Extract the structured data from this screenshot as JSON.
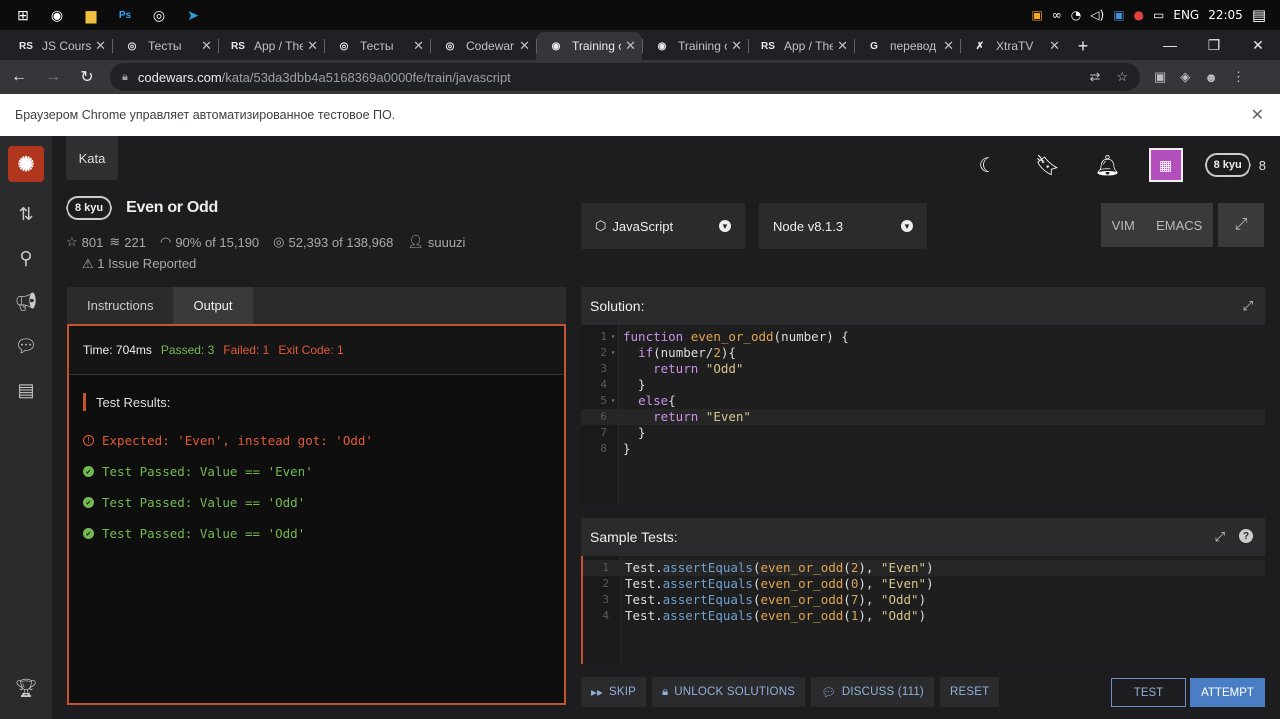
{
  "taskbar": {
    "tray_lang": "ENG",
    "clock": "22:05"
  },
  "tabs": [
    {
      "fav": "RS",
      "title": "JS Course",
      "active": false
    },
    {
      "fav": "◎",
      "title": "Тесты",
      "active": false
    },
    {
      "fav": "RS",
      "title": "App / The",
      "active": false
    },
    {
      "fav": "◎",
      "title": "Тесты",
      "active": false
    },
    {
      "fav": "◎",
      "title": "Codewar",
      "active": false
    },
    {
      "fav": "◉",
      "title": "Training c",
      "active": true
    },
    {
      "fav": "◉",
      "title": "Training c",
      "active": false
    },
    {
      "fav": "RS",
      "title": "App / The",
      "active": false
    },
    {
      "fav": "G",
      "title": "перевод",
      "active": false
    },
    {
      "fav": "✗",
      "title": "XtraTV",
      "active": false
    }
  ],
  "address": {
    "host": "codewars.com",
    "path": "/kata/53da3dbb4a5168369a0000fe/train/javascript"
  },
  "infobar": {
    "text": "Браузером Chrome управляет автоматизированное тестовое ПО."
  },
  "nav": {
    "kata_label": "Kata",
    "user_rank": "8 kyu",
    "honor": "8"
  },
  "kata": {
    "rank": "8 kyu",
    "title": "Even or Odd",
    "stars": "801",
    "collections": "221",
    "satisfaction": "90% of 15,190",
    "completed": "52,393 of 138,968",
    "author": "suuuzi",
    "issues": "1 Issue Reported"
  },
  "language_select": "JavaScript",
  "version_select": "Node v8.1.3",
  "modes": {
    "vim": "VIM",
    "emacs": "EMACS"
  },
  "left_tabs": {
    "instructions": "Instructions",
    "output": "Output"
  },
  "output": {
    "time": "Time: 704ms",
    "passed": "Passed: 3",
    "failed": "Failed: 1",
    "exit": "Exit Code: 1",
    "results_title": "Test Results:",
    "lines": [
      {
        "status": "error",
        "text": "Expected: 'Even', instead got: 'Odd'"
      },
      {
        "status": "passed",
        "text": "Test Passed: Value == 'Even'"
      },
      {
        "status": "passed",
        "text": "Test Passed: Value == 'Odd'"
      },
      {
        "status": "passed",
        "text": "Test Passed: Value == 'Odd'"
      }
    ]
  },
  "solution": {
    "header": "Solution:",
    "lines": [
      "function even_or_odd(number) {",
      "  if(number/2){",
      "    return \"Odd\"",
      "  }",
      "  else{",
      "    return \"Even\"",
      "  }",
      "}"
    ]
  },
  "sample_tests": {
    "header": "Sample Tests:",
    "lines": [
      "Test.assertEquals(even_or_odd(2), \"Even\")",
      "Test.assertEquals(even_or_odd(0), \"Even\")",
      "Test.assertEquals(even_or_odd(7), \"Odd\")",
      "Test.assertEquals(even_or_odd(1), \"Odd\")"
    ]
  },
  "actions": {
    "skip": "SKIP",
    "unlock": "UNLOCK SOLUTIONS",
    "discuss": "DISCUSS (111)",
    "reset": "RESET",
    "test": "TEST",
    "attempt": "ATTEMPT"
  },
  "colors": {
    "accent": "#c4532f",
    "passed": "#74b852",
    "failed": "#e05a3a",
    "attempt": "#4a7ec4"
  }
}
